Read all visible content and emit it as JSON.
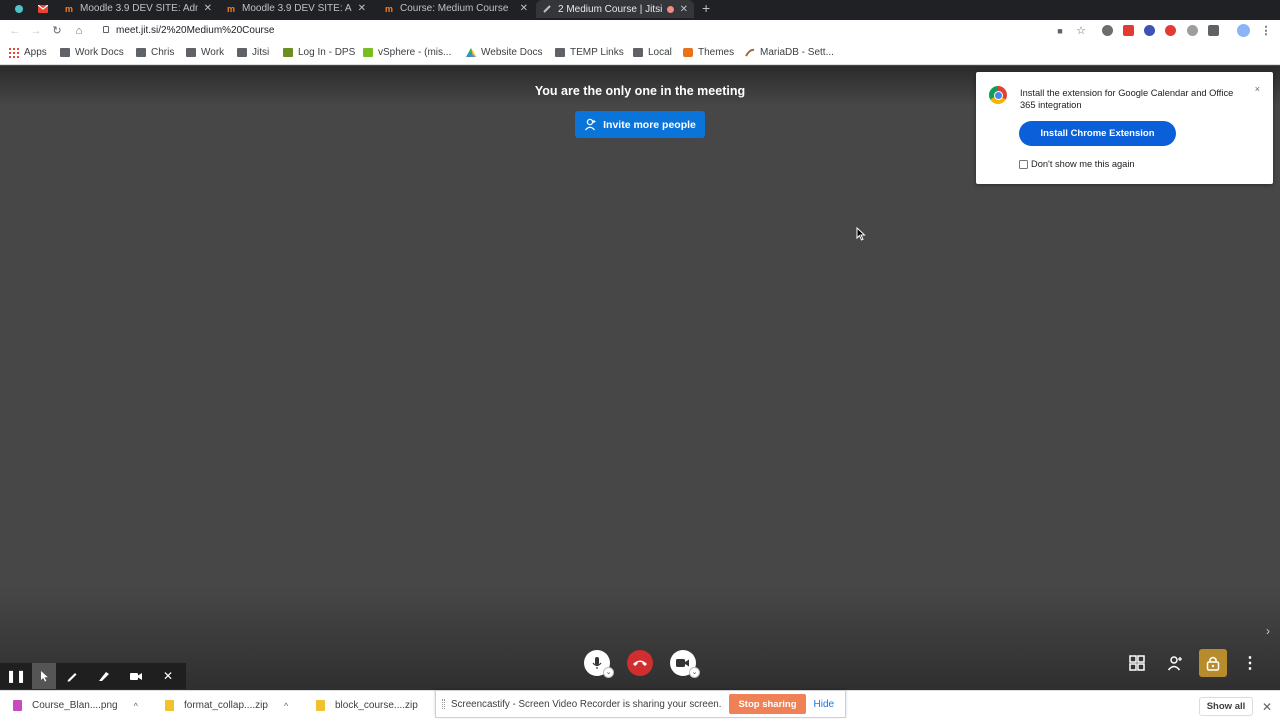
{
  "browser": {
    "tabs": [
      {
        "title": "",
        "favicon": "chrome-blue-dot-icon",
        "color": "#4a90e2"
      },
      {
        "title": "",
        "favicon": "gmail-icon",
        "color": "#ea4335"
      },
      {
        "title": "Moodle 3.9 DEV SITE: Adm",
        "favicon": "moodle-icon",
        "color": "#f98012"
      },
      {
        "title": "Moodle 3.9 DEV SITE: Adm",
        "favicon": "moodle-icon",
        "color": "#f98012"
      },
      {
        "title": "Course: Medium Course",
        "favicon": "moodle-icon",
        "color": "#f98012"
      },
      {
        "title": "2 Medium Course | Jitsi",
        "favicon": "jitsi-icon",
        "color": "#bdc1c6"
      }
    ],
    "new_tab_label": "+",
    "address": "meet.jit.si/2%20Medium%20Course",
    "bookmarks": [
      {
        "label": "Apps",
        "icon": "apps-grid-icon"
      },
      {
        "label": "Work Docs",
        "icon": "folder-icon"
      },
      {
        "label": "Chris",
        "icon": "folder-icon"
      },
      {
        "label": "Work",
        "icon": "folder-icon"
      },
      {
        "label": "Jitsi",
        "icon": "folder-icon"
      },
      {
        "label": "Log In - DPS",
        "icon": "page-icon"
      },
      {
        "label": "vSphere - (mis...",
        "icon": "vsphere-icon"
      },
      {
        "label": "Website Docs",
        "icon": "drive-icon"
      },
      {
        "label": "TEMP Links",
        "icon": "folder-icon"
      },
      {
        "label": "Local",
        "icon": "folder-icon"
      },
      {
        "label": "Themes",
        "icon": "themes-icon"
      },
      {
        "label": "MariaDB - Sett...",
        "icon": "mariadb-icon"
      }
    ]
  },
  "meeting": {
    "status_text": "You are the only one in the meeting",
    "invite_label": "Invite more people",
    "accent_color": "#0a74d9"
  },
  "extension_popup": {
    "message": "Install the extension for Google Calendar and Office 365 integration",
    "install_label": "Install Chrome Extension",
    "checkbox_label": "Don't show me this again",
    "close_label": "×"
  },
  "download_bar": {
    "items": [
      {
        "name": "Course_Blan....png",
        "color": "#c74bbf"
      },
      {
        "name": "format_collap....zip",
        "color": "#f2c12e"
      },
      {
        "name": "block_course....zip",
        "color": "#f2c12e"
      }
    ],
    "show_all_label": "Show all"
  },
  "screencastify": {
    "message": "Screencastify - Screen Video Recorder is sharing your screen.",
    "stop_label": "Stop sharing",
    "hide_label": "Hide"
  }
}
